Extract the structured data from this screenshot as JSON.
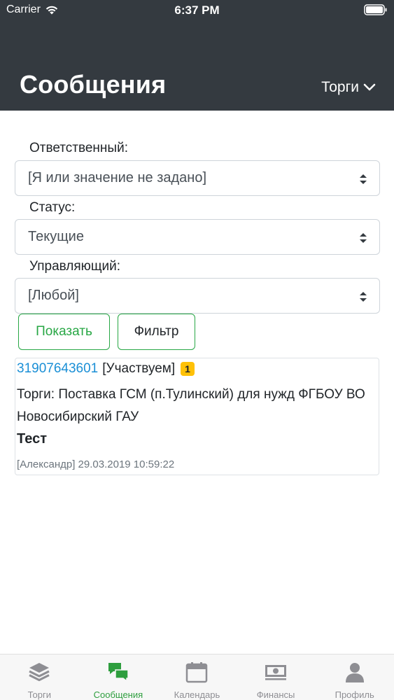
{
  "status_bar": {
    "carrier": "Carrier",
    "time": "6:37 PM"
  },
  "header": {
    "title": "Сообщения",
    "menu_label": "Торги"
  },
  "filters": {
    "responsible": {
      "label": "Ответственный:",
      "value": "[Я или значение не задано]"
    },
    "status": {
      "label": "Статус:",
      "value": "Текущие"
    },
    "manager": {
      "label": "Управляющий:",
      "value": "[Любой]"
    }
  },
  "buttons": {
    "show": "Показать",
    "filter": "Фильтр"
  },
  "messages": [
    {
      "id": "31907643601",
      "participation": "[Участвуем]",
      "count": "1",
      "subject": "Торги: Поставка ГСМ (п.Тулинский) для нужд ФГБОУ ВО Новосибирский ГАУ",
      "text": "Тест",
      "meta": "[Александр] 29.03.2019 10:59:22"
    }
  ],
  "tabbar": {
    "active": "messages",
    "items": [
      {
        "key": "auctions",
        "label": "Торги",
        "icon": "layers-icon"
      },
      {
        "key": "messages",
        "label": "Сообщения",
        "icon": "chat-bubbles-icon"
      },
      {
        "key": "calendar",
        "label": "Календарь",
        "icon": "calendar-icon"
      },
      {
        "key": "finance",
        "label": "Финансы",
        "icon": "money-icon"
      },
      {
        "key": "profile",
        "label": "Профиль",
        "icon": "user-icon"
      }
    ]
  },
  "colors": {
    "header_bg": "#343a40",
    "accent_green": "#28a745",
    "link_blue": "#1a8fd6",
    "badge_yellow": "#ffc107"
  }
}
